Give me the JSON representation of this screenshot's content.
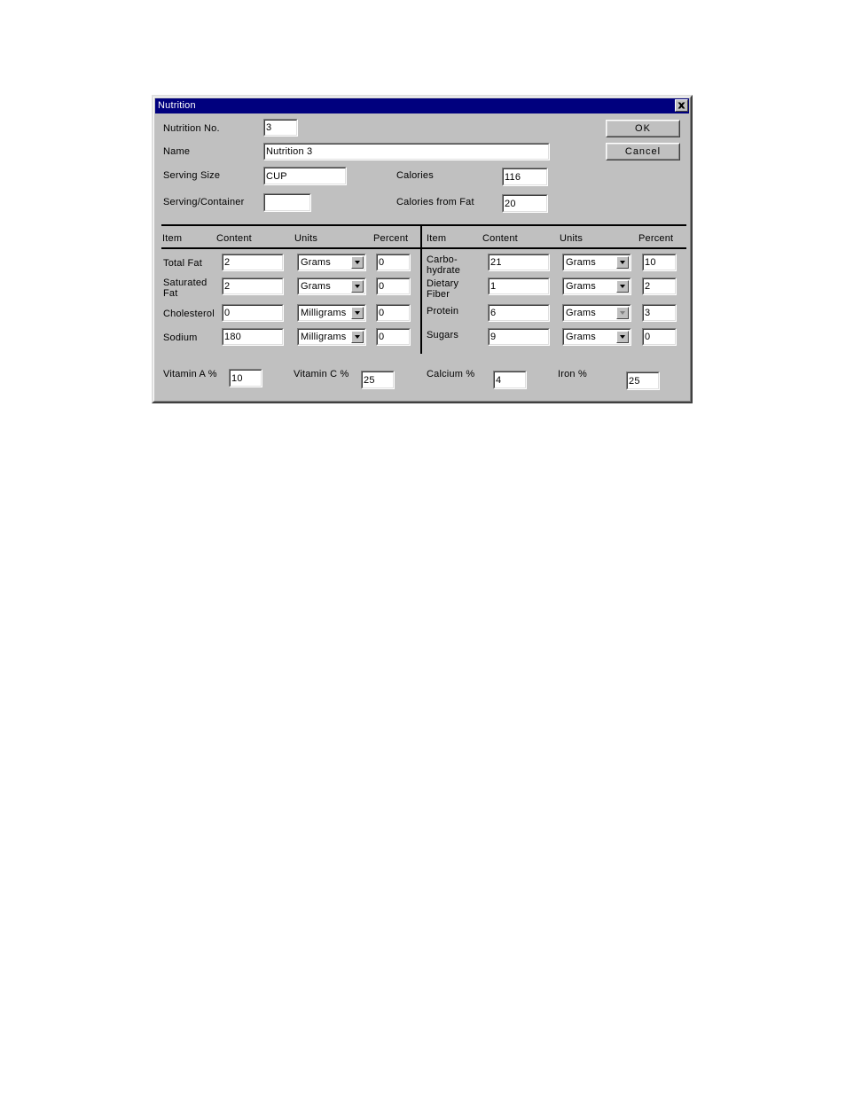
{
  "window": {
    "title": "Nutrition",
    "close_icon": "close-icon"
  },
  "buttons": {
    "ok": "OK",
    "cancel": "Cancel"
  },
  "header_fields": {
    "nutrition_no": {
      "label": "Nutrition No.",
      "value": "3"
    },
    "name": {
      "label": "Name",
      "value": "Nutrition 3"
    },
    "serving_size": {
      "label": "Serving Size",
      "value": "CUP"
    },
    "serving_container": {
      "label": "Serving/Container",
      "value": ""
    },
    "calories": {
      "label": "Calories",
      "value": "116"
    },
    "calories_from_fat": {
      "label": "Calories from Fat",
      "value": "20"
    }
  },
  "columns": {
    "item": "Item",
    "content": "Content",
    "units": "Units",
    "percent": "Percent"
  },
  "left_table": {
    "rows": [
      {
        "item": "Total Fat",
        "item_line2": "",
        "content": "2",
        "units": "Grams",
        "percent": "0",
        "units_disabled": false
      },
      {
        "item": "Saturated",
        "item_line2": "Fat",
        "content": "2",
        "units": "Grams",
        "percent": "0",
        "units_disabled": false
      },
      {
        "item": "Cholesterol",
        "item_line2": "",
        "content": "0",
        "units": "Milligrams",
        "percent": "0",
        "units_disabled": false
      },
      {
        "item": "Sodium",
        "item_line2": "",
        "content": "180",
        "units": "Milligrams",
        "percent": "0",
        "units_disabled": false
      }
    ]
  },
  "right_table": {
    "rows": [
      {
        "item": "Carbo-",
        "item_line2": "hydrate",
        "content": "21",
        "units": "Grams",
        "percent": "10",
        "units_disabled": false
      },
      {
        "item": "Dietary",
        "item_line2": "Fiber",
        "content": "1",
        "units": "Grams",
        "percent": "2",
        "units_disabled": false
      },
      {
        "item": "Protein",
        "item_line2": "",
        "content": "6",
        "units": "Grams",
        "percent": "3",
        "units_disabled": true
      },
      {
        "item": "Sugars",
        "item_line2": "",
        "content": "9",
        "units": "Grams",
        "percent": "0",
        "units_disabled": false
      }
    ]
  },
  "vitamins": {
    "vitamin_a": {
      "label": "Vitamin A %",
      "value": "10"
    },
    "vitamin_c": {
      "label": "Vitamin C %",
      "value": "25"
    },
    "calcium": {
      "label": "Calcium %",
      "value": "4"
    },
    "iron": {
      "label": "Iron %",
      "value": "25"
    }
  },
  "units_options": [
    "Grams",
    "Milligrams"
  ]
}
